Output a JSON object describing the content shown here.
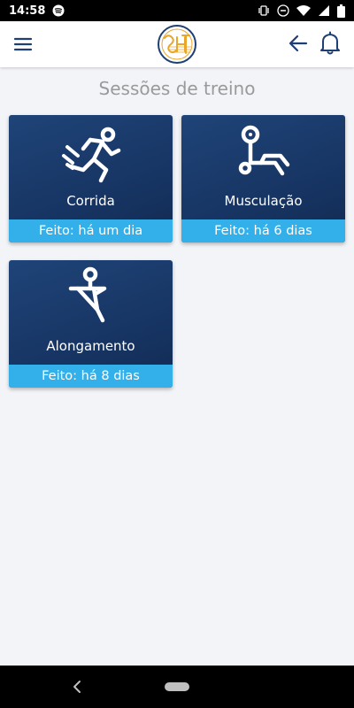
{
  "status_bar": {
    "time": "14:58",
    "icons": [
      "spotify-icon",
      "vibrate-icon",
      "do-not-disturb-icon",
      "wifi-icon",
      "signal-icon",
      "battery-icon"
    ]
  },
  "app_bar": {
    "icons": [
      "menu-icon",
      "app-logo",
      "back-arrow-icon",
      "bell-icon"
    ],
    "accent_color": "#1d3f73",
    "logo_color": "#e8a62a"
  },
  "page_title": "Sessões de treino",
  "sessions": [
    {
      "label": "Corrida",
      "status": "Feito: há um dia",
      "icon": "running-icon"
    },
    {
      "label": "Musculação",
      "status": "Feito: há 6 dias",
      "icon": "weightlifting-icon"
    },
    {
      "label": "Alongamento",
      "status": "Feito: há 8 dias",
      "icon": "stretching-icon"
    }
  ],
  "colors": {
    "card_background": "#1a3a6b",
    "card_footer": "#33b0ea",
    "page_background": "#f3f4f8",
    "title_text": "#9a9a9a"
  }
}
